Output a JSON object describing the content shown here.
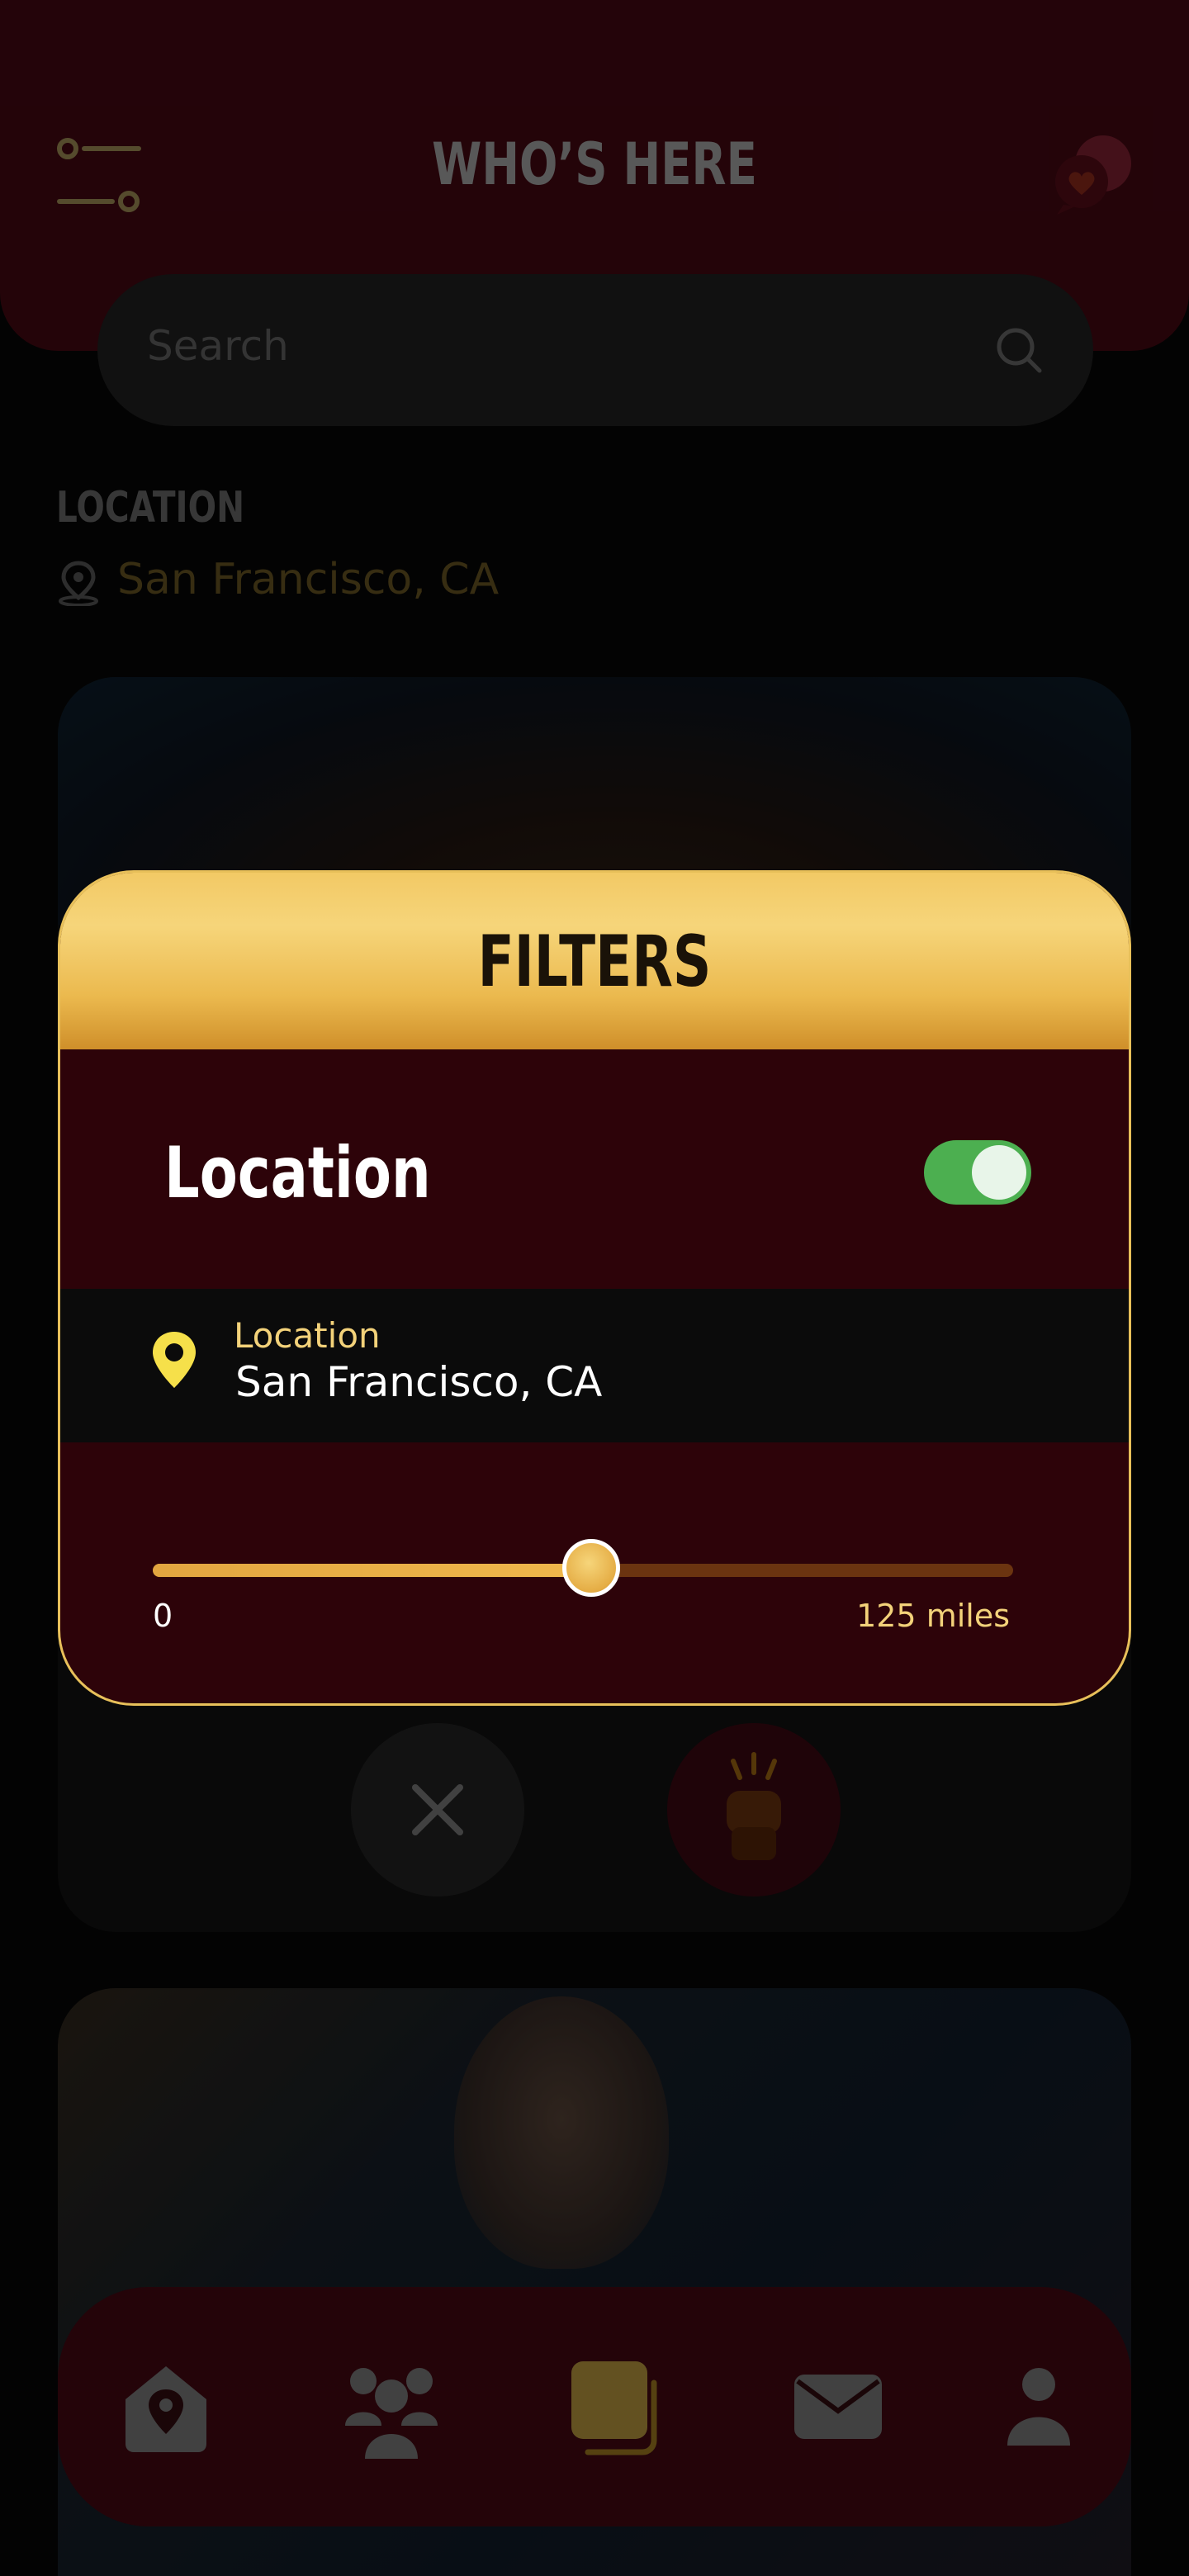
{
  "header": {
    "title": "WHO’S HERE"
  },
  "search": {
    "placeholder": "Search"
  },
  "location_section": {
    "label": "LOCATION",
    "value": "San Francisco, CA"
  },
  "filters_modal": {
    "title": "FILTERS",
    "location_toggle": {
      "label": "Location",
      "enabled": true
    },
    "location_field": {
      "label": "Location",
      "value": "San Francisco, CA"
    },
    "distance_slider": {
      "min_label": "0",
      "max_label": "125 miles",
      "min": 0,
      "max": 125,
      "value_fraction": 0.51
    }
  },
  "tabbar": {
    "items": [
      "home-location",
      "people",
      "cards",
      "messages",
      "profile"
    ],
    "active": "cards"
  },
  "colors": {
    "accent_gold": "#f0c060",
    "header_maroon": "#3a0710",
    "toggle_green": "#4caf50"
  }
}
